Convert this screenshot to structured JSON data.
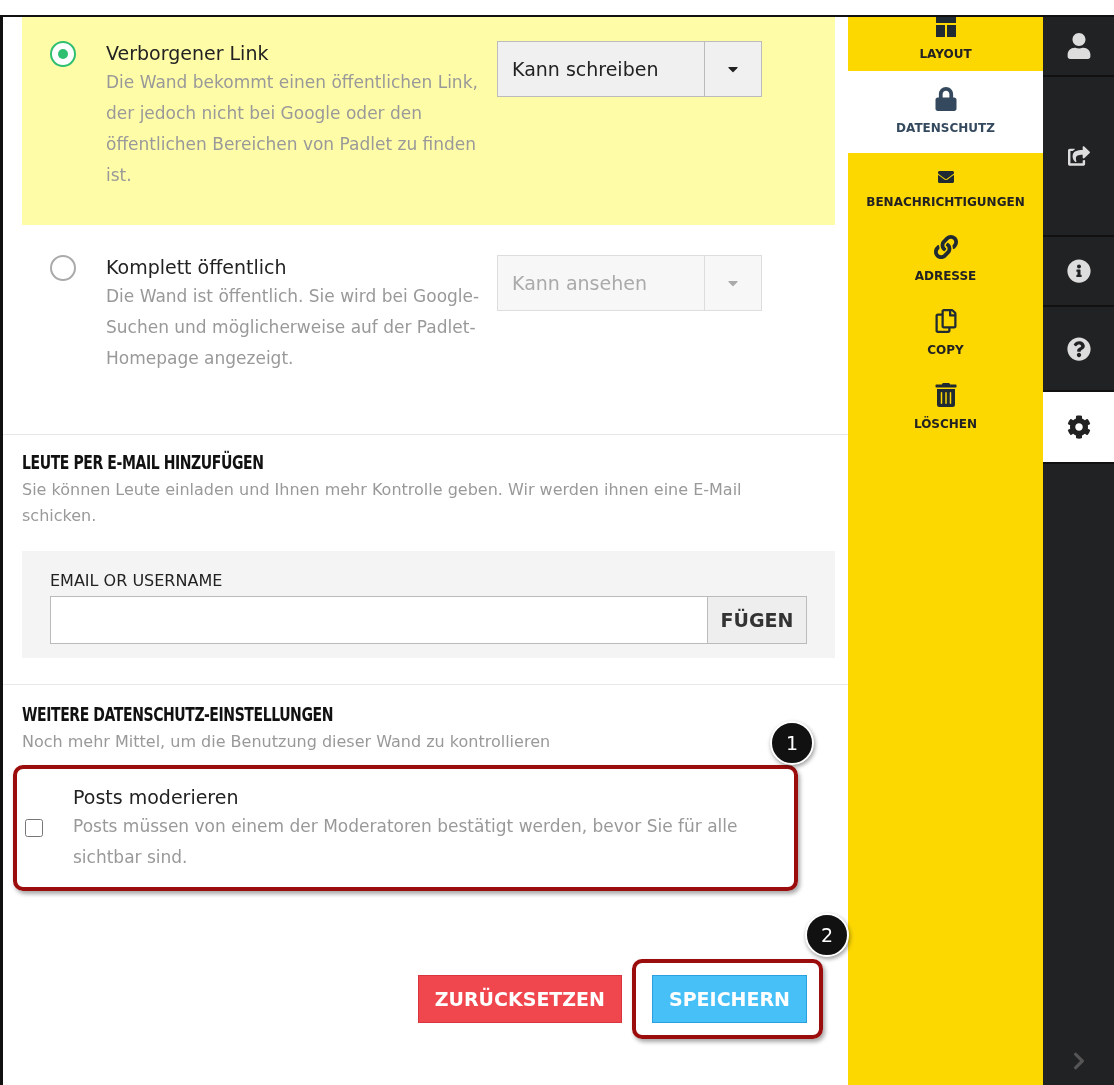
{
  "privacy_options": [
    {
      "title": "Verborgener Link",
      "description": "Die Wand bekommt einen öffentlichen Link, der jedoch nicht bei Google oder den öffentlichen Bereichen von Padlet zu finden ist.",
      "selected": true,
      "permission": {
        "value": "Kann schreiben",
        "disabled": false
      }
    },
    {
      "title": "Komplett öffentlich",
      "description": "Die Wand ist öffentlich. Sie wird bei Google-Suchen und möglicherweise auf der Padlet-Homepage angezeigt.",
      "selected": false,
      "permission": {
        "value": "Kann ansehen",
        "disabled": true
      }
    }
  ],
  "invite": {
    "heading": "LEUTE PER E-MAIL HINZUFÜGEN",
    "description": "Sie können Leute einladen und Ihnen mehr Kontrolle geben. Wir werden ihnen eine E-Mail schicken.",
    "field_label": "EMAIL OR USERNAME",
    "button": "FÜGEN"
  },
  "more_settings": {
    "heading": "WEITERE DATENSCHUTZ-EINSTELLUNGEN",
    "description": "Noch mehr Mittel, um die Benutzung dieser Wand zu kontrollieren",
    "options": [
      {
        "title": "Posts moderieren",
        "description": "Posts müssen von einem der Moderatoren bestätigt werden, bevor Sie für alle sichtbar sind.",
        "checked": false
      }
    ]
  },
  "actions": [
    {
      "label": "ZURÜCKSETZEN",
      "kind": "reset"
    },
    {
      "label": "SPEICHERN",
      "kind": "save"
    }
  ],
  "callouts": [
    {
      "number": "1"
    },
    {
      "number": "2"
    }
  ],
  "sidebar": {
    "items": [
      {
        "label": "LAYOUT",
        "selected": false
      },
      {
        "label": "DATENSCHUTZ",
        "selected": true
      },
      {
        "label": "BENACHRICHTIGUNGEN",
        "selected": false
      },
      {
        "label": "ADRESSE",
        "selected": false
      },
      {
        "label": "COPY",
        "selected": false
      },
      {
        "label": "LÖSCHEN",
        "selected": false
      }
    ]
  },
  "rail": {
    "items": [
      {
        "selected": false
      },
      {
        "selected": false
      },
      {
        "selected": false
      },
      {
        "selected": false
      },
      {
        "selected": true
      }
    ]
  }
}
